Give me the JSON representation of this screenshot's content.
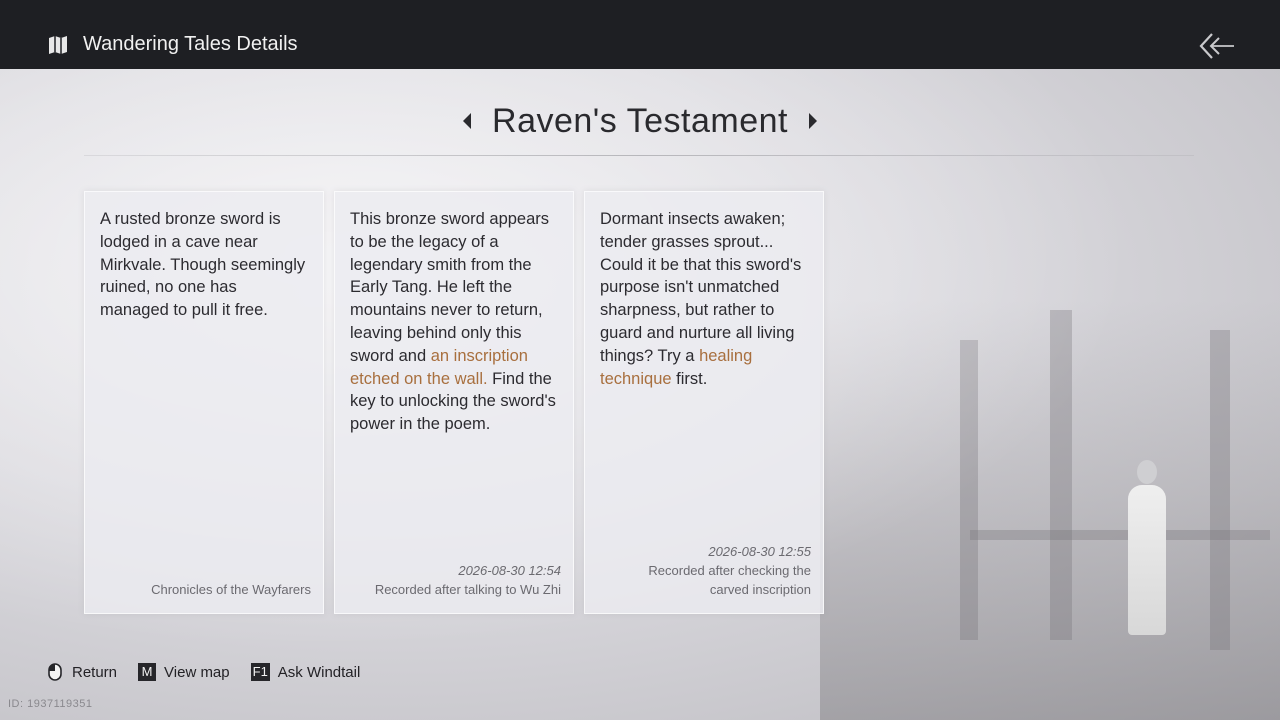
{
  "header": {
    "title": "Wandering Tales Details",
    "icon": "book-map-icon",
    "back_icon": "back-arrow-icon"
  },
  "tale": {
    "name": "Raven's Testament"
  },
  "cards": [
    {
      "text": "A rusted bronze sword is lodged in a cave near Mirkvale. Though seemingly ruined, no one has managed to pull it free.",
      "date": "",
      "note": "Chronicles of the Wayfarers"
    },
    {
      "text_before": "This bronze sword appears to be the legacy of a legendary smith from the Early Tang. He left the mountains never to return, leaving behind only this sword and ",
      "highlight": "an inscription etched on the wall.",
      "text_after": " Find the key to unlocking the sword's power in the poem.",
      "date": "2026-08-30 12:54",
      "note": "Recorded after talking to Wu Zhi"
    },
    {
      "text_before": "Dormant insects awaken; tender grasses sprout... Could it be that this sword's purpose isn't unmatched sharpness, but rather to guard and nurture all living things? Try a ",
      "highlight": "healing technique",
      "text_after": " first.",
      "date": "2026-08-30 12:55",
      "note": "Recorded after checking the carved inscription"
    }
  ],
  "controls": {
    "return_label": "Return",
    "map_key": "M",
    "map_label": "View map",
    "ask_key": "F1",
    "ask_label": "Ask Windtail"
  },
  "uid": "ID: 1937119351",
  "colors": {
    "highlight": "#a86f3e",
    "topbar": "#1e1f23"
  }
}
